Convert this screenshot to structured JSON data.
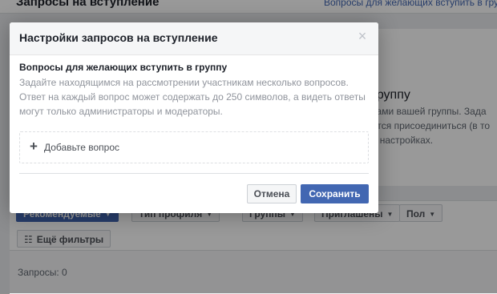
{
  "background": {
    "header_title": "Запросы на вступление",
    "header_link": "Вопросы для желающих вступить в группу",
    "card_heading": "группу",
    "card_text": "ками вашей группы. Зада\nотся присоединиться (в то\nв настройках.",
    "filters": [
      {
        "label": "Рекомендуемые",
        "primary": true
      },
      {
        "label": "Тип профиля"
      },
      {
        "label": "Группы"
      },
      {
        "label": "Приглашены"
      },
      {
        "label": "Пол"
      }
    ],
    "more_filters": "Ещё фильтры",
    "requests_label": "Запросы: 0"
  },
  "modal": {
    "title": "Настройки запросов на вступление",
    "close_icon": "close-icon",
    "section_title": "Вопросы для желающих вступить в группу",
    "section_desc": "Задайте находящимся на рассмотрении участникам несколько вопросов. Ответ на каждый вопрос может содержать до 250 символов, а видеть ответы могут только администраторы и модераторы.",
    "add_question_icon": "+",
    "add_question_label": "Добавьте вопрос",
    "cancel_label": "Отмена",
    "save_label": "Сохранить"
  },
  "colors": {
    "accent": "#4267b2",
    "overlay": "rgba(0,0,0,0.40)"
  }
}
